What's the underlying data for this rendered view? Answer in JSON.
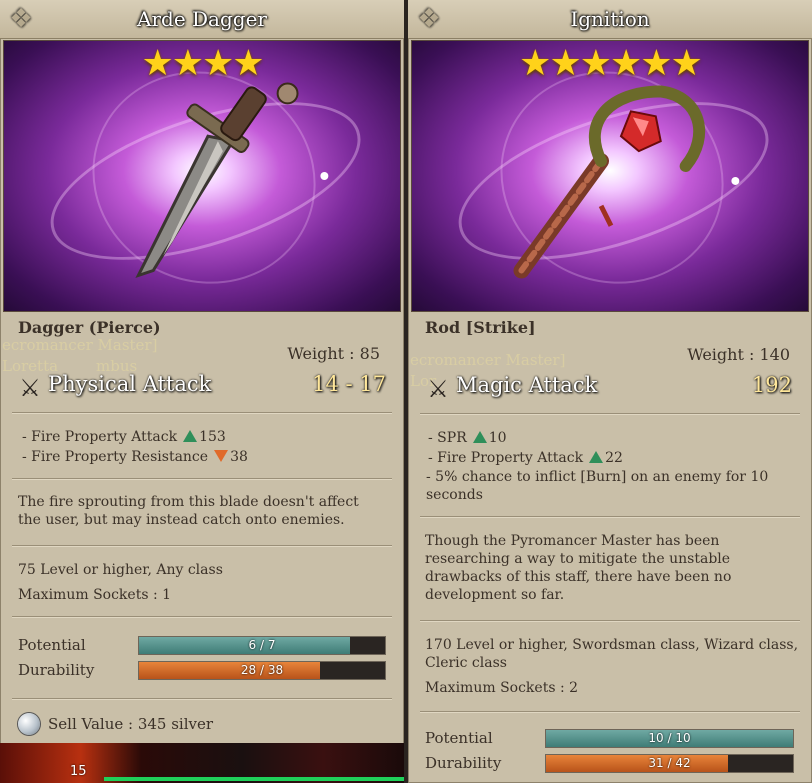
{
  "left": {
    "title": "Arde Dagger",
    "stars": "★★★★",
    "type": "Dagger (Pierce)",
    "ghost1": "ecromancer Master]",
    "ghost2": "Loretta",
    "ghost3": "mbus",
    "weight": "Weight : 85",
    "attack_label": "Physical Attack",
    "attack_value": "14 - 17",
    "props": [
      {
        "text": "- Fire Property Attack",
        "dir": "up",
        "value": "153"
      },
      {
        "text": "- Fire Property Resistance",
        "dir": "down",
        "value": "38"
      }
    ],
    "description": "The fire sprouting from this blade doesn't affect the user, but may instead catch onto enemies.",
    "requirement": "75 Level or higher, Any class",
    "sockets": "Maximum Sockets : 1",
    "potential": {
      "label": "Potential",
      "text": "6 / 7",
      "current": 6,
      "max": 7
    },
    "durability": {
      "label": "Durability",
      "text": "28 / 38",
      "current": 28,
      "max": 38
    },
    "sell": "Sell Value : 345 silver",
    "hud_level": "15"
  },
  "right": {
    "title": "Ignition",
    "stars": "★★★★★★",
    "type": "Rod [Strike]",
    "ghost1": "ecromancer Master]",
    "ghost2": "Lor",
    "weight": "Weight : 140",
    "attack_label": "Magic Attack",
    "attack_value": "192",
    "props": [
      {
        "text": "- SPR",
        "dir": "up",
        "value": "10"
      },
      {
        "text": "- Fire Property Attack",
        "dir": "up",
        "value": "22"
      },
      {
        "text": "- 5% chance to inflict [Burn] on an enemy for 10 seconds",
        "dir": "",
        "value": ""
      }
    ],
    "description": "Though the Pyromancer Master has been researching a way to mitigate the unstable drawbacks of this staff, there have been no development so far.",
    "requirement": "170 Level or higher, Swordsman class, Wizard class, Cleric class",
    "sockets": "Maximum Sockets : 2",
    "potential": {
      "label": "Potential",
      "text": "10 / 10",
      "current": 10,
      "max": 10
    },
    "durability": {
      "label": "Durability",
      "text": "31 / 42",
      "current": 31,
      "max": 42
    }
  },
  "colors": {
    "star": "#ffd21a",
    "attack_value": "#ffe79a",
    "up_arrow": "#2f8f5a",
    "down_arrow": "#e06a2a"
  },
  "icons": {
    "attack": "crossed-swords-icon",
    "sell": "silver-coin-icon"
  }
}
